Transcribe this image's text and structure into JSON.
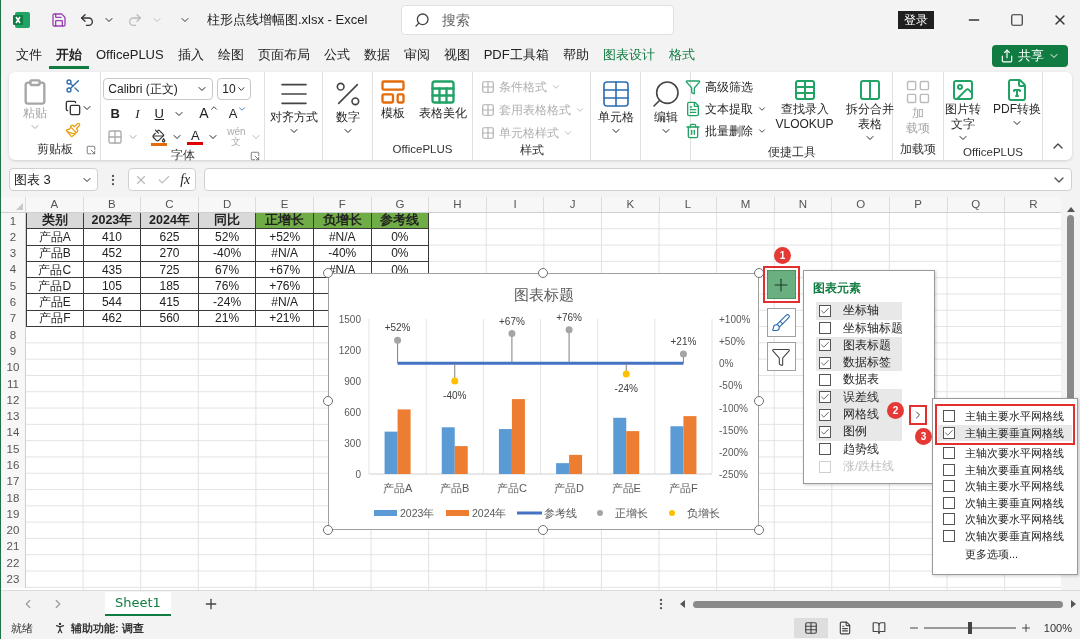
{
  "titlebar": {
    "title": "柱形点线增幅图.xlsx - Excel",
    "search": {
      "placeholder": "搜索"
    },
    "login": "登录",
    "redo_disabled": true
  },
  "tabs": [
    {
      "label": "文件",
      "selected": false,
      "kind": "normal"
    },
    {
      "label": "开始",
      "selected": true,
      "kind": "normal"
    },
    {
      "label": "OfficePLUS",
      "selected": false,
      "kind": "normal"
    },
    {
      "label": "插入",
      "selected": false,
      "kind": "normal"
    },
    {
      "label": "绘图",
      "selected": false,
      "kind": "normal"
    },
    {
      "label": "页面布局",
      "selected": false,
      "kind": "normal"
    },
    {
      "label": "公式",
      "selected": false,
      "kind": "normal"
    },
    {
      "label": "数据",
      "selected": false,
      "kind": "normal"
    },
    {
      "label": "审阅",
      "selected": false,
      "kind": "normal"
    },
    {
      "label": "视图",
      "selected": false,
      "kind": "normal"
    },
    {
      "label": "PDF工具箱",
      "selected": false,
      "kind": "normal"
    },
    {
      "label": "帮助",
      "selected": false,
      "kind": "normal"
    },
    {
      "label": "图表设计",
      "selected": false,
      "kind": "contextual"
    },
    {
      "label": "格式",
      "selected": false,
      "kind": "contextual"
    }
  ],
  "share": "共享",
  "ribbon": {
    "clipboard": {
      "label": "剪贴板",
      "paste": {
        "label": "粘贴",
        "disabled": true
      }
    },
    "font": {
      "label": "字体",
      "font_name": "Calibri (正文)",
      "font_size": "10",
      "bold": "B",
      "italic": "I",
      "underline": "U",
      "grow": "A",
      "shrink": "A",
      "font_color": "A",
      "phonetic": {
        "top": "wén",
        "bottom": "文",
        "disabled": true
      }
    },
    "alignment": {
      "label": "对齐方式"
    },
    "number": {
      "label": "数字"
    },
    "officeplus": {
      "label": "OfficePLUS",
      "items": [
        "模板",
        "表格美化"
      ]
    },
    "styles": {
      "label": "样式",
      "items": [
        {
          "label": "条件格式",
          "disabled": true
        },
        {
          "label": "套用表格格式",
          "disabled": true
        },
        {
          "label": "单元格样式",
          "disabled": true
        }
      ]
    },
    "cells": {
      "label": "单元格"
    },
    "editing": {
      "label": "编辑"
    },
    "tools": {
      "label": "便捷工具",
      "small": [
        {
          "label": "高级筛选",
          "dropdown": false
        },
        {
          "label": "文本提取",
          "dropdown": true
        },
        {
          "label": "批量删除",
          "dropdown": true
        }
      ],
      "large": [
        {
          "lines": [
            "查找录入",
            "VLOOKUP"
          ],
          "dropdown": false
        },
        {
          "lines": [
            "拆分合并",
            "表格"
          ],
          "dropdown": true
        }
      ]
    },
    "addins": {
      "label": "加载项",
      "button": {
        "lines": [
          "加",
          "载项"
        ],
        "disabled": true
      }
    },
    "officeplus2": {
      "label": "OfficePLUS",
      "items": [
        {
          "lines": [
            "图片转",
            "文字"
          ]
        },
        {
          "lines": [
            "PDF转换"
          ]
        }
      ]
    }
  },
  "formula_bar": {
    "name_box": "图表 3",
    "fx": "fx"
  },
  "sheet": {
    "columns": [
      "A",
      "B",
      "C",
      "D",
      "E",
      "F",
      "G",
      "H",
      "I",
      "J",
      "K",
      "L",
      "M",
      "N",
      "O",
      "P",
      "Q",
      "R"
    ],
    "row_numbers": [
      "1",
      "2",
      "3",
      "4",
      "5",
      "6",
      "7",
      "8",
      "9",
      "10",
      "11",
      "12",
      "13",
      "14",
      "15",
      "16",
      "17",
      "18",
      "19",
      "20",
      "21",
      "22",
      "23"
    ],
    "header": [
      {
        "text": "类别",
        "kind": "plain"
      },
      {
        "text": "2023年",
        "kind": "plain"
      },
      {
        "text": "2024年",
        "kind": "plain"
      },
      {
        "text": "同比",
        "kind": "plain"
      },
      {
        "text": "正增长",
        "kind": "accent"
      },
      {
        "text": "负增长",
        "kind": "accent"
      },
      {
        "text": "参考线",
        "kind": "accent"
      }
    ],
    "rows": [
      [
        "产品A",
        "410",
        "625",
        "52%",
        "+52%",
        "#N/A",
        "0%"
      ],
      [
        "产品B",
        "452",
        "270",
        "-40%",
        "#N/A",
        "-40%",
        "0%"
      ],
      [
        "产品C",
        "435",
        "725",
        "67%",
        "+67%",
        "#N/A",
        "0%"
      ],
      [
        "产品D",
        "105",
        "185",
        "76%",
        "+76%"
      ],
      [
        "产品E",
        "544",
        "415",
        "-24%",
        "#N/A"
      ],
      [
        "产品F",
        "462",
        "560",
        "21%",
        "+21%"
      ]
    ]
  },
  "chart": {
    "chart_data": {
      "type": "bar",
      "title": "图表标题",
      "categories": [
        "产品A",
        "产品B",
        "产品C",
        "产品D",
        "产品E",
        "产品F"
      ],
      "ylim": [
        0,
        1500
      ],
      "yticks": [
        0,
        300,
        600,
        900,
        1200,
        1500
      ],
      "y2lim": [
        -2.5,
        1
      ],
      "legend": "bottom",
      "y2ticks": [
        {
          "value": 1,
          "label": "+100%"
        },
        {
          "value": 0.5,
          "label": "+50%"
        },
        {
          "value": 0,
          "label": "0%"
        },
        {
          "value": -0.5,
          "label": "-50%"
        },
        {
          "value": -1,
          "label": "-100%"
        },
        {
          "value": -1.5,
          "label": "-150%"
        },
        {
          "value": -2,
          "label": "-200%"
        },
        {
          "value": -2.5,
          "label": "-250%"
        }
      ],
      "series": [
        {
          "name": "2023年",
          "color": "#5b9bd5",
          "type": "bar",
          "values": [
            410,
            452,
            435,
            105,
            544,
            462
          ]
        },
        {
          "name": "2024年",
          "color": "#ed7d31",
          "type": "bar",
          "values": [
            625,
            270,
            725,
            185,
            415,
            560
          ]
        },
        {
          "name": "参考线",
          "color": "#4472c4",
          "type": "line",
          "axis": "y2",
          "values": [
            0,
            0,
            0,
            0,
            0,
            0
          ]
        },
        {
          "name": "正增长",
          "color": "#a5a5a5",
          "type": "scatter",
          "axis": "y2",
          "values": [
            0.52,
            null,
            0.67,
            0.76,
            null,
            0.21
          ],
          "value_labels": [
            "+52%",
            null,
            "+67%",
            "+76%",
            null,
            "+21%"
          ]
        },
        {
          "name": "负增长",
          "color": "#ffc000",
          "type": "scatter",
          "axis": "y2",
          "values": [
            null,
            -0.4,
            null,
            null,
            -0.24,
            null
          ],
          "value_labels": [
            null,
            "-40%",
            null,
            null,
            "-24%",
            null
          ]
        }
      ]
    }
  },
  "chart_buttons": [
    {
      "selected": true,
      "highlighted": true
    },
    {
      "selected": false,
      "highlighted": false
    },
    {
      "selected": false,
      "highlighted": false
    }
  ],
  "elements_menu": {
    "title": "图表元素",
    "items": [
      {
        "label": "坐标轴",
        "checked": true,
        "disabled": false
      },
      {
        "label": "坐标轴标题",
        "checked": false,
        "disabled": false
      },
      {
        "label": "图表标题",
        "checked": true,
        "disabled": false
      },
      {
        "label": "数据标签",
        "checked": true,
        "disabled": false
      },
      {
        "label": "数据表",
        "checked": false,
        "disabled": false
      },
      {
        "label": "误差线",
        "checked": true,
        "disabled": false
      },
      {
        "label": "网格线",
        "checked": true,
        "disabled": false,
        "submenu_button": {
          "highlighted": true
        }
      },
      {
        "label": "图例",
        "checked": true,
        "disabled": false
      },
      {
        "label": "趋势线",
        "checked": false,
        "disabled": false
      },
      {
        "label": "涨/跌柱线",
        "checked": false,
        "disabled": true
      }
    ]
  },
  "gridlines_menu": {
    "items": [
      {
        "label": "主轴主要水平网格线",
        "checked": false,
        "highlighted": true,
        "selected": false
      },
      {
        "label": "主轴主要垂直网格线",
        "checked": true,
        "highlighted": true,
        "selected": true
      },
      {
        "label": "主轴次要水平网格线",
        "checked": false,
        "highlighted": false,
        "selected": false
      },
      {
        "label": "主轴次要垂直网格线",
        "checked": false,
        "highlighted": false,
        "selected": false
      },
      {
        "label": "次轴主要水平网格线",
        "checked": false,
        "highlighted": false,
        "selected": false
      },
      {
        "label": "次轴主要垂直网格线",
        "checked": false,
        "highlighted": false,
        "selected": false
      },
      {
        "label": "次轴次要水平网格线",
        "checked": false,
        "highlighted": false,
        "selected": false
      },
      {
        "label": "次轴次要垂直网格线",
        "checked": false,
        "highlighted": false,
        "selected": false
      }
    ],
    "more": "更多选项..."
  },
  "callouts": [
    "1",
    "2",
    "3"
  ],
  "sheet_tabs": [
    {
      "label": "Sheet1",
      "selected": true
    }
  ],
  "status": {
    "ready": "就绪",
    "accessibility": "辅助功能: 调查",
    "views": [
      {
        "selected": true
      },
      {
        "selected": false
      },
      {
        "selected": false
      }
    ],
    "zoom": {
      "level": 0.5,
      "reading": "100%"
    }
  }
}
